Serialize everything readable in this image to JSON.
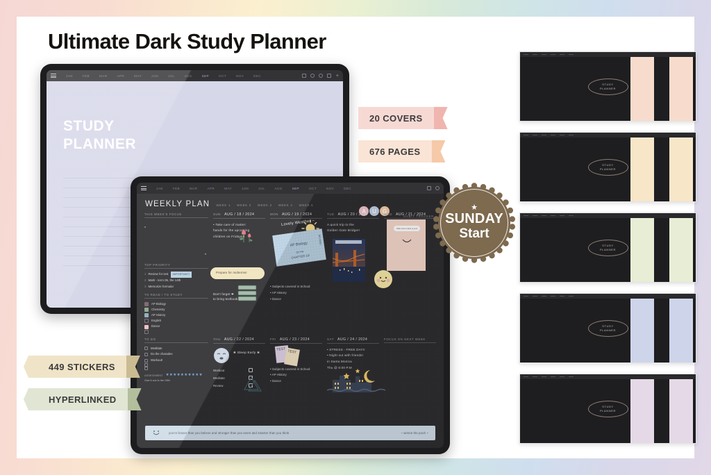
{
  "title": "Ultimate Dark Study Planner",
  "frame_gradient_colors": [
    "#f6d7d4",
    "#fae5cf",
    "#fbf0cf",
    "#d8ead8",
    "#cfe5e6",
    "#d8d8ea",
    "#e2d8e8"
  ],
  "ribbons": [
    {
      "label": "20 COVERS",
      "body_color": "#f7d9d4",
      "tail_color": "#efb5ae",
      "side": "right"
    },
    {
      "label": "676 PAGES",
      "body_color": "#fae4d6",
      "tail_color": "#f6c9a8",
      "side": "right"
    },
    {
      "label": "449 STICKERS",
      "body_color": "#f0e4c8",
      "tail_color": "#cbbb93",
      "side": "left"
    },
    {
      "label": "HYPERLINKED",
      "body_color": "#e0e6d3",
      "tail_color": "#b3bf9c",
      "side": "left"
    }
  ],
  "badge": {
    "star": "★",
    "line1": "SUNDAY",
    "line2": "Start",
    "color": "#7d6a4f"
  },
  "tablet_one": {
    "toolbar": {
      "months": [
        "JAN",
        "FEB",
        "MAR",
        "APR",
        "MAY",
        "JUN",
        "JUL",
        "AUG",
        "SEP",
        "OCT",
        "NOV",
        "DEC"
      ],
      "active_month": "SEP",
      "icons": [
        "menu-icon",
        "save-icon",
        "clock-icon",
        "info-icon",
        "bookmark-icon",
        "plus-icon"
      ],
      "plus": "+"
    },
    "cover_page": {
      "line1": "STUDY",
      "line2": "PLANNER",
      "background": "#d6d7e8"
    }
  },
  "tablet_two": {
    "toolbar": {
      "months": [
        "JAN",
        "FEB",
        "MAR",
        "APR",
        "MAY",
        "JUN",
        "JUL",
        "AUG",
        "SEP",
        "OCT",
        "NOV",
        "DEC"
      ],
      "active_month": "SEP"
    },
    "page_title": "WEEKLY PLAN",
    "week_tabs": [
      "WEEK 1",
      "WEEK 2",
      "WEEK 3",
      "WEEK 4",
      "WEEK 5"
    ],
    "month_bubbles": [
      {
        "letter": "A",
        "color": "#f3c6ce"
      },
      {
        "letter": "U",
        "color": "#c3cfe6"
      },
      {
        "letter": "G",
        "color": "#f6ceab"
      }
    ],
    "habit_tracker_label": "HABIT TRACKER",
    "focus": {
      "heading": "THIS WEEK'S FOCUS",
      "quote_open": "“",
      "quote_close": "”"
    },
    "top_priority": {
      "heading": "TOP PRIORITY",
      "items": [
        {
          "n": "1",
          "text": "Review for test",
          "tag": "IMPORTANT!"
        },
        {
          "n": "2",
          "text": "Math - term 05, the 14th",
          "tag": ""
        },
        {
          "n": "3",
          "text": "Memorize formula!",
          "tag": ""
        }
      ]
    },
    "to_read": {
      "heading": "TO READ / TO STUDY",
      "items": [
        {
          "label": "AP Biology",
          "color": "#7a5f6b"
        },
        {
          "label": "Chemistry",
          "color": "#8aa588"
        },
        {
          "label": "AP History",
          "color": "#8fa8bd"
        },
        {
          "label": "English",
          "color": ""
        },
        {
          "label": "Dance",
          "color": "#f0bcc4"
        },
        {
          "label": "",
          "color": ""
        }
      ]
    },
    "todo": {
      "heading": "TO DO",
      "items": [
        "Meditate",
        "Do the charades",
        "Workout!",
        "",
        ""
      ]
    },
    "assessment": {
      "label": "ASSESSMENT",
      "stars": "★★★★★★★★★★",
      "note": "Give it one to the 10th!"
    },
    "days": [
      {
        "name": "SUN",
        "date": "AUG / 18 / 2024",
        "notes": [
          "• Take care of matter:",
          "hands for the upcoming",
          "children on Fridays!!"
        ]
      },
      {
        "name": "MON",
        "date": "AUG / 19 / 2024",
        "notes": [],
        "weather": "Lovely Weather ~",
        "card": {
          "title": "AP Biology",
          "sub": "Q2 Hw",
          "sub2": "CHAPTER 10!",
          "side": "REVISED"
        },
        "blob": "Prepare for midterms!",
        "books_note": [
          "Don't forget ❤",
          "to bring textbook"
        ]
      },
      {
        "name": "TUE",
        "date": "AUG / 20 / 2024",
        "notes": [
          "A quick trip to the",
          "Golden Gate Bridge!!"
        ]
      },
      {
        "name": "WED",
        "date": "AUG / 21 / 2024",
        "notes": [],
        "speech": "Take some notes to you!"
      },
      {
        "name": "THU",
        "date": "AUG / 22 / 2024",
        "sleep_note": "❀ Sleep Early ❀",
        "checks": [
          "Workout",
          "Meditate",
          "Review"
        ]
      },
      {
        "name": "FRI",
        "date": "AUG / 23 / 2024",
        "test_labels": [
          "TEST",
          "TEST"
        ],
        "bullets": [
          "• Subjects covered in School:",
          "• AP History",
          "• Dance"
        ]
      },
      {
        "name": "SAT",
        "date": "AUG / 24 / 2024",
        "notes": [
          "• STRESS - FREE DAY!!",
          "• Night out with friends!",
          "   in Santa Monica",
          "   Thu @ 6:00 P.M"
        ]
      }
    ],
    "next_week_heading": "FOCUS ON NEXT WEEK",
    "bottom_banner": {
      "smiley": "smiley-icon",
      "text": "you're braver than you believe and stronger than you seem and smarter than you think",
      "right": "~ winnie the pooh ~"
    },
    "monday_bullets": [
      "• Subjects covered in School:",
      "• AP History",
      "• Dance"
    ]
  },
  "covers": {
    "caption_line1": "STUDY",
    "caption_line2": "PLANNER",
    "items": [
      {
        "name": "cover-pink",
        "accent": "#f7dccd"
      },
      {
        "name": "cover-cream",
        "accent": "#f8e6c9"
      },
      {
        "name": "cover-green",
        "accent": "#e7eed5"
      },
      {
        "name": "cover-periwinkle",
        "accent": "#ced5ea"
      },
      {
        "name": "cover-lilac",
        "accent": "#e5d9e7"
      }
    ]
  }
}
